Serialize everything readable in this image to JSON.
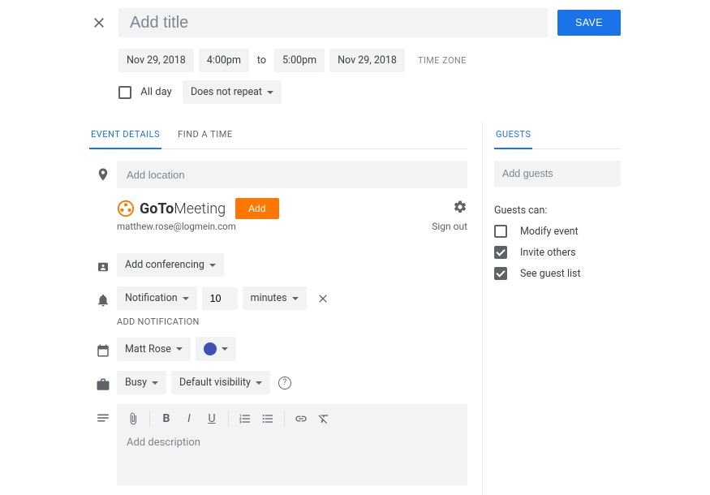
{
  "header": {
    "title_placeholder": "Add title",
    "save_label": "SAVE"
  },
  "date": {
    "start_date": "Nov 29, 2018",
    "start_time": "4:00pm",
    "to": "to",
    "end_time": "5:00pm",
    "end_date": "Nov 29, 2018",
    "timezone_label": "TIME ZONE"
  },
  "allday": {
    "label": "All day",
    "repeat": "Does not repeat"
  },
  "tabs": {
    "details": "EVENT DETAILS",
    "findtime": "FIND A TIME",
    "guests": "GUESTS"
  },
  "location": {
    "placeholder": "Add location"
  },
  "gtm": {
    "brand_goto": "GoTo",
    "brand_meeting": "Meeting",
    "add": "Add",
    "email": "matthew.rose@logmein.com",
    "signout": "Sign out"
  },
  "conferencing": {
    "label": "Add conferencing"
  },
  "notification": {
    "type": "Notification",
    "value": "10",
    "unit": "minutes",
    "add_label": "ADD NOTIFICATION"
  },
  "calendar": {
    "owner": "Matt Rose"
  },
  "availability": {
    "busy": "Busy",
    "visibility": "Default visibility"
  },
  "description": {
    "placeholder": "Add description"
  },
  "guests": {
    "placeholder": "Add guests",
    "can_label": "Guests can:",
    "modify": "Modify event",
    "invite": "Invite others",
    "seelist": "See guest list"
  }
}
